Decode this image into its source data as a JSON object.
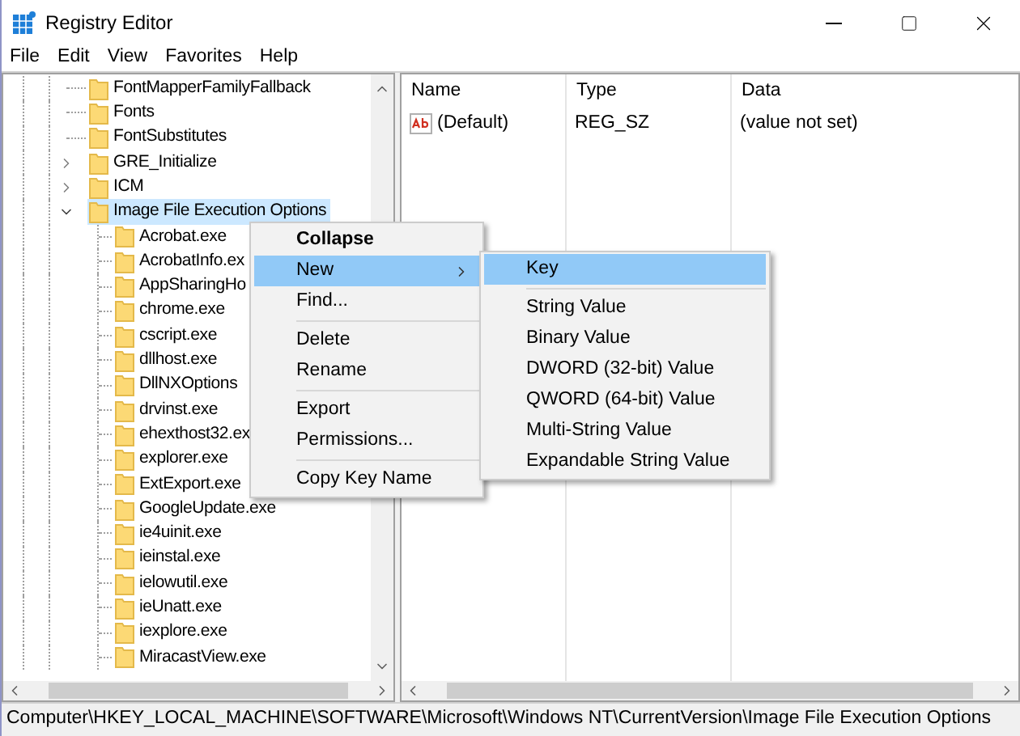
{
  "window": {
    "title": "Registry Editor"
  },
  "menu_bar": [
    "File",
    "Edit",
    "View",
    "Favorites",
    "Help"
  ],
  "tree": [
    {
      "label": "FontMapperFamilyFallback",
      "kind": "leaf",
      "selected": false
    },
    {
      "label": "Fonts",
      "kind": "leaf",
      "selected": false
    },
    {
      "label": "FontSubstitutes",
      "kind": "leaf",
      "selected": false
    },
    {
      "label": "GRE_Initialize",
      "kind": "branch",
      "expanded": false,
      "selected": false
    },
    {
      "label": "ICM",
      "kind": "branch",
      "expanded": false,
      "selected": false
    },
    {
      "label": "Image File Execution Options",
      "kind": "branch",
      "expanded": true,
      "selected": true,
      "children": [
        {
          "label": "Acrobat.exe",
          "selected": false
        },
        {
          "label": "AcrobatInfo.ex",
          "selected": false
        },
        {
          "label": "AppSharingHo",
          "selected": false
        },
        {
          "label": "chrome.exe",
          "selected": false
        },
        {
          "label": "cscript.exe",
          "selected": false
        },
        {
          "label": "dllhost.exe",
          "selected": false
        },
        {
          "label": "DllNXOptions",
          "selected": false
        },
        {
          "label": "drvinst.exe",
          "selected": false
        },
        {
          "label": "ehexthost32.ex",
          "selected": false
        },
        {
          "label": "explorer.exe",
          "selected": false
        },
        {
          "label": "ExtExport.exe",
          "selected": false
        },
        {
          "label": "GoogleUpdate.exe",
          "selected": false
        },
        {
          "label": "ie4uinit.exe",
          "selected": false
        },
        {
          "label": "ieinstal.exe",
          "selected": false
        },
        {
          "label": "ielowutil.exe",
          "selected": false
        },
        {
          "label": "ieUnatt.exe",
          "selected": false
        },
        {
          "label": "iexplore.exe",
          "selected": false
        },
        {
          "label": "MiracastView.exe",
          "selected": false
        }
      ]
    }
  ],
  "values_table": {
    "columns": [
      "Name",
      "Type",
      "Data"
    ],
    "rows": [
      {
        "name": "(Default)",
        "type": "REG_SZ",
        "data": "(value not set)"
      }
    ]
  },
  "context_menu": [
    {
      "kind": "item",
      "label": "Collapse",
      "bold": true,
      "selected": false,
      "has_submenu": false
    },
    {
      "kind": "item",
      "label": "New",
      "bold": false,
      "selected": true,
      "has_submenu": true
    },
    {
      "kind": "item",
      "label": "Find...",
      "bold": false,
      "selected": false,
      "has_submenu": false
    },
    {
      "kind": "separator"
    },
    {
      "kind": "item",
      "label": "Delete",
      "bold": false,
      "selected": false,
      "has_submenu": false
    },
    {
      "kind": "item",
      "label": "Rename",
      "bold": false,
      "selected": false,
      "has_submenu": false
    },
    {
      "kind": "separator"
    },
    {
      "kind": "item",
      "label": "Export",
      "bold": false,
      "selected": false,
      "has_submenu": false
    },
    {
      "kind": "item",
      "label": "Permissions...",
      "bold": false,
      "selected": false,
      "has_submenu": false
    },
    {
      "kind": "separator"
    },
    {
      "kind": "item",
      "label": "Copy Key Name",
      "bold": false,
      "selected": false,
      "has_submenu": false
    }
  ],
  "submenu": [
    {
      "kind": "item",
      "label": "Key",
      "selected": true
    },
    {
      "kind": "separator"
    },
    {
      "kind": "item",
      "label": "String Value",
      "selected": false
    },
    {
      "kind": "item",
      "label": "Binary Value",
      "selected": false
    },
    {
      "kind": "item",
      "label": "DWORD (32-bit) Value",
      "selected": false
    },
    {
      "kind": "item",
      "label": "QWORD (64-bit) Value",
      "selected": false
    },
    {
      "kind": "item",
      "label": "Multi-String Value",
      "selected": false
    },
    {
      "kind": "item",
      "label": "Expandable String Value",
      "selected": false
    }
  ],
  "status_bar": "Computer\\HKEY_LOCAL_MACHINE\\SOFTWARE\\Microsoft\\Windows NT\\CurrentVersion\\Image File Execution Options"
}
